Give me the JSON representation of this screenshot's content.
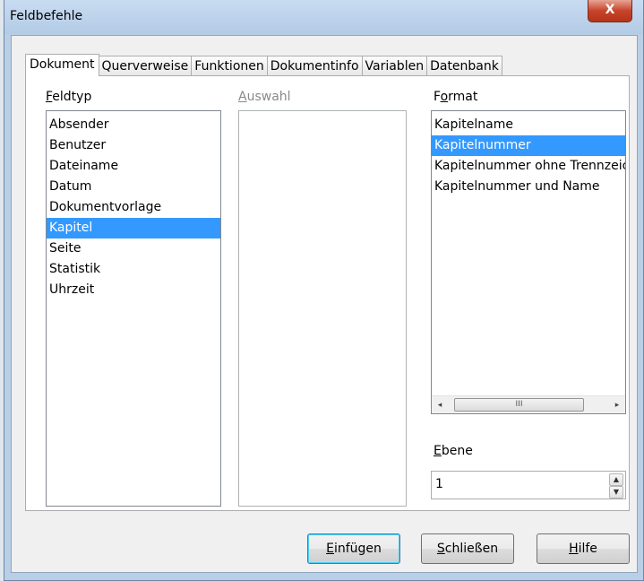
{
  "window": {
    "title": "Feldbefehle",
    "close_label": "X"
  },
  "tabs": [
    {
      "label": "Dokument",
      "active": true
    },
    {
      "label": "Querverweise",
      "active": false
    },
    {
      "label": "Funktionen",
      "active": false
    },
    {
      "label": "Dokumentinfo",
      "active": false
    },
    {
      "label": "Variablen",
      "active": false
    },
    {
      "label": "Datenbank",
      "active": false
    }
  ],
  "feldtyp": {
    "label_ul": "F",
    "label_rest": "eldtyp",
    "items": [
      "Absender",
      "Benutzer",
      "Dateiname",
      "Datum",
      "Dokumentvorlage",
      "Kapitel",
      "Seite",
      "Statistik",
      "Uhrzeit"
    ],
    "selected": "Kapitel"
  },
  "auswahl": {
    "label_ul": "A",
    "label_rest": "uswahl",
    "items": []
  },
  "format": {
    "label_pre": "F",
    "label_ul": "o",
    "label_rest": "rmat",
    "items": [
      "Kapitelname",
      "Kapitelnummer",
      "Kapitelnummer ohne Trennzeichen",
      "Kapitelnummer und Name"
    ],
    "selected": "Kapitelnummer",
    "scroll_left": "◂",
    "scroll_right": "▸",
    "scroll_grip": "III"
  },
  "ebene": {
    "label_ul": "E",
    "label_rest": "bene",
    "value": "1",
    "up": "▲",
    "down": "▼"
  },
  "buttons": {
    "einfuegen": {
      "ul": "E",
      "rest": "infügen"
    },
    "schliessen": {
      "ul": "S",
      "rest": "chließen"
    },
    "hilfe": {
      "ul": "H",
      "rest": "ilfe"
    }
  }
}
